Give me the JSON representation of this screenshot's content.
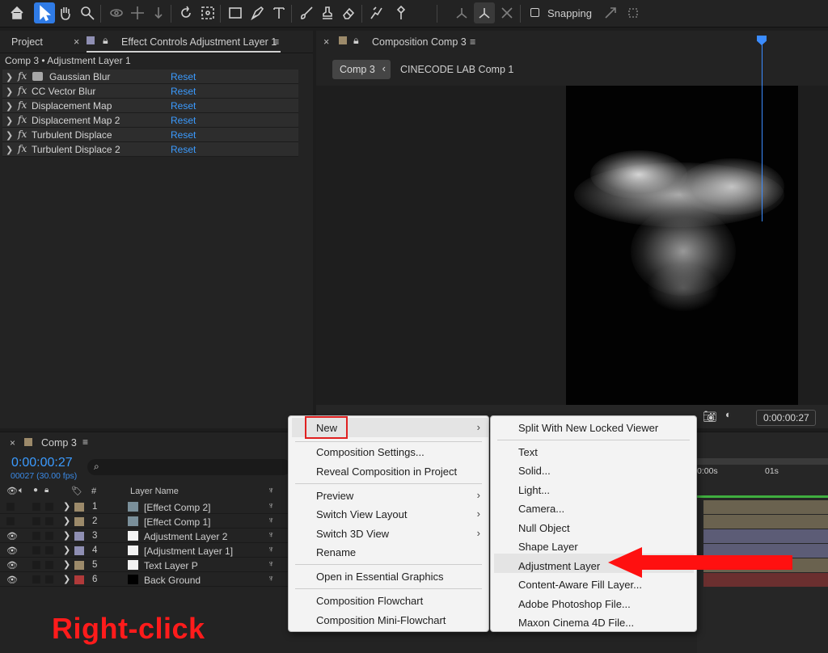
{
  "toolbar": {
    "snapping_label": "Snapping",
    "tools": [
      "home-icon",
      "selection-tool-icon",
      "hand-tool-icon",
      "zoom-tool-icon",
      "orbit-tool-icon",
      "pan-tool-icon",
      "dolly-tool-icon",
      "rotate-tool-icon",
      "pan-behind-tool-icon",
      "rectangle-tool-icon",
      "pen-tool-icon",
      "type-tool-icon",
      "brush-tool-icon",
      "clone-stamp-tool-icon",
      "eraser-tool-icon",
      "roto-brush-tool-icon",
      "puppet-tool-icon"
    ]
  },
  "left_panel": {
    "project_tab": "Project",
    "effect_controls_tab": "Effect Controls Adjustment Layer 1",
    "header": "Comp 3 • Adjustment Layer 1",
    "reset_label": "Reset",
    "effects": [
      {
        "name": "Gaussian Blur",
        "has_icon": true
      },
      {
        "name": "CC Vector Blur",
        "has_icon": false
      },
      {
        "name": "Displacement Map",
        "has_icon": false
      },
      {
        "name": "Displacement Map 2",
        "has_icon": false
      },
      {
        "name": "Turbulent Displace",
        "has_icon": false
      },
      {
        "name": "Turbulent Displace 2",
        "has_icon": false
      }
    ]
  },
  "composition_panel": {
    "tab_title": "Composition Comp 3",
    "breadcrumb_active": "Comp 3",
    "breadcrumb_other": "CINECODE LAB Comp 1",
    "timecode": "0:00:00:27"
  },
  "timeline": {
    "tab_title": "Comp 3",
    "current_time": "0:00:00:27",
    "fps_info": "00027 (30.00 fps)",
    "column_layer_name": "Layer Name",
    "column_number": "#",
    "ruler_0": "0:00s",
    "ruler_1": "01s",
    "layers": [
      {
        "num": "1",
        "name": "[Effect Comp 2]",
        "label_color": "#9c8a6a",
        "visible": false
      },
      {
        "num": "2",
        "name": "[Effect Comp 1]",
        "label_color": "#9c8a6a",
        "visible": false
      },
      {
        "num": "3",
        "name": "Adjustment Layer 2",
        "label_color": "#8f8fb3",
        "visible": true
      },
      {
        "num": "4",
        "name": "[Adjustment Layer 1]",
        "label_color": "#8f8fb3",
        "visible": true
      },
      {
        "num": "5",
        "name": "Text Layer P",
        "label_color": "#9c8a6a",
        "visible": true
      },
      {
        "num": "6",
        "name": "Back Ground",
        "label_color": "#b03a3a",
        "visible": true
      }
    ]
  },
  "context_menu": {
    "items": [
      {
        "label": "New",
        "submenu": true
      },
      {
        "label": "Composition Settings...",
        "submenu": false
      },
      {
        "label": "Reveal Composition in Project",
        "submenu": false
      },
      {
        "label": "Preview",
        "submenu": true
      },
      {
        "label": "Switch View Layout",
        "submenu": true
      },
      {
        "label": "Switch 3D View",
        "submenu": true
      },
      {
        "label": "Rename",
        "submenu": false
      },
      {
        "label": "Open in Essential Graphics",
        "submenu": false
      },
      {
        "label": "Composition Flowchart",
        "submenu": false
      },
      {
        "label": "Composition Mini-Flowchart",
        "submenu": false
      }
    ]
  },
  "new_submenu": {
    "items": [
      "Split With New Locked Viewer",
      "Text",
      "Solid...",
      "Light...",
      "Camera...",
      "Null Object",
      "Shape Layer",
      "Adjustment Layer",
      "Content-Aware Fill Layer...",
      "Adobe Photoshop File...",
      "Maxon Cinema 4D File..."
    ],
    "highlighted": "Adjustment Layer"
  },
  "annotation": {
    "text": "Right-click",
    "color": "#ff1b1b"
  },
  "colors": {
    "accent_blue": "#3b9bff",
    "highlight_red": "#e02020"
  }
}
